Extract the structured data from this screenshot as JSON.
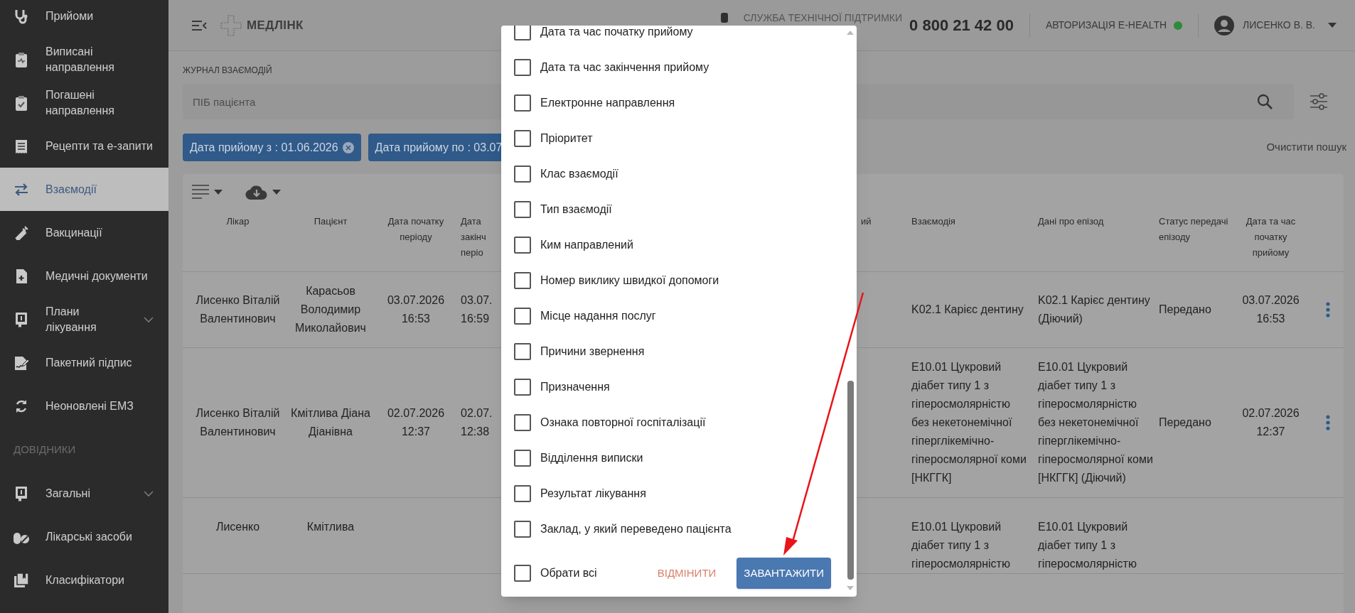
{
  "sidebar": {
    "items": [
      {
        "kind": "item",
        "label": "Прийоми",
        "selected": false,
        "expandable": false
      },
      {
        "kind": "item",
        "label": "Виписані направлення",
        "selected": false,
        "expandable": false
      },
      {
        "kind": "item",
        "label": "Погашені направлення",
        "selected": false,
        "expandable": false
      },
      {
        "kind": "item",
        "label": "Рецепти та е-запити",
        "selected": false,
        "expandable": false
      },
      {
        "kind": "item",
        "label": "Взаємодії",
        "selected": true,
        "expandable": false
      },
      {
        "kind": "item",
        "label": "Вакцинації",
        "selected": false,
        "expandable": false
      },
      {
        "kind": "item",
        "label": "Медичні документи",
        "selected": false,
        "expandable": false
      },
      {
        "kind": "item",
        "label": "Плани лікування",
        "selected": false,
        "expandable": true
      },
      {
        "kind": "item",
        "label": "Пакетний підпис",
        "selected": false,
        "expandable": false
      },
      {
        "kind": "item",
        "label": "Неоновлені ЕМЗ",
        "selected": false,
        "expandable": false
      },
      {
        "kind": "section",
        "label": "ДОВІДНИКИ"
      },
      {
        "kind": "item",
        "label": "Загальні",
        "selected": false,
        "expandable": true
      },
      {
        "kind": "item",
        "label": "Лікарські засоби",
        "selected": false,
        "expandable": false
      },
      {
        "kind": "item",
        "label": "Класифікатори",
        "selected": false,
        "expandable": false
      }
    ]
  },
  "header": {
    "logo_text": "МЕДЛІНК",
    "support_label": "СЛУЖБА ТЕХНІЧНОЇ ПІДТРИМКИ",
    "phone": "0 800 21 42 00",
    "auth_label": "АВТОРИЗАЦІЯ E-HEALTH",
    "auth_connected": true,
    "user_name": "ЛИСЕНКО В. В."
  },
  "breadcrumb": "ЖУРНАЛ ВЗАЄМОДІЙ",
  "search": {
    "placeholder": "ПІБ пацієнта"
  },
  "filters": [
    {
      "label": "Дата прийому з : 01.06.2026"
    },
    {
      "label": "Дата прийому по : 03.07"
    }
  ],
  "clear_search": "Очистити пошук",
  "table": {
    "left_columns": [
      "Лікар",
      "Пацієнт",
      "Дата початку періоду",
      "Дата закінч періо"
    ],
    "partial_column": "ий",
    "right_columns": [
      "Взаємодія",
      "Дані про епізод",
      "Статус передачі епізоду",
      "Дата та час початку прийому"
    ],
    "rows": [
      {
        "left": [
          "Лисенко Віталій Валентинович",
          "Карасьов Володимир Миколайович",
          "03.07.2026 16:53",
          "03.07. 16:59"
        ],
        "right": [
          "K02.1 Карієс дентину",
          "K02.1 Карієс дентину (Діючий)",
          "Передано",
          "03.07.2026 16:53"
        ],
        "actions": true,
        "cut": false
      },
      {
        "left": [
          "Лисенко Віталій Валентинович",
          "Кмітлива Діана Діанівна",
          "02.07.2026 12:37",
          "02.07. 12:38"
        ],
        "right": [
          "E10.01 Цукровий діабет типу 1 з гіперосмолярністю без некетонемічної гіперглікемічно-гіперосмолярної коми [НКГГК]",
          "E10.01 Цукровий діабет типу 1 з гіперосмолярністю без некетонемічної гіперглікемічно-гіперосмолярної коми [НКГГК] (Діючий)",
          "Передано",
          "02.07.2026 12:37"
        ],
        "actions": true,
        "cut": false
      },
      {
        "left": [
          "Лисенко",
          "Кмітлива"
        ],
        "right": [
          "E10.01 Цукровий діабет типу 1 з гіперосмолярністю",
          "E10.01 Цукровий діабет типу 1 з гіперосмолярністю"
        ],
        "actions": false,
        "cut": true
      }
    ]
  },
  "export_dialog": {
    "options": [
      {
        "label": "Дата та час початку прийому",
        "checked": false
      },
      {
        "label": "Дата та час закінчення прийому",
        "checked": false
      },
      {
        "label": "Електронне направлення",
        "checked": false
      },
      {
        "label": "Пріоритет",
        "checked": false
      },
      {
        "label": "Клас взаємодії",
        "checked": false
      },
      {
        "label": "Тип взаємодії",
        "checked": false
      },
      {
        "label": "Ким направлений",
        "checked": false
      },
      {
        "label": "Номер виклику швидкої допомоги",
        "checked": false
      },
      {
        "label": "Місце надання послуг",
        "checked": false
      },
      {
        "label": "Причини звернення",
        "checked": false
      },
      {
        "label": "Призначення",
        "checked": false
      },
      {
        "label": "Ознака повторної госпіталізації",
        "checked": false
      },
      {
        "label": "Відділення виписки",
        "checked": false
      },
      {
        "label": "Результат лікування",
        "checked": false
      },
      {
        "label": "Заклад, у який переведено пацієнта",
        "checked": false
      }
    ],
    "select_all": {
      "label": "Обрати всі",
      "checked": false
    },
    "cancel": "ВІДМІНИТИ",
    "submit": "ЗАВАНТАЖИТИ"
  }
}
